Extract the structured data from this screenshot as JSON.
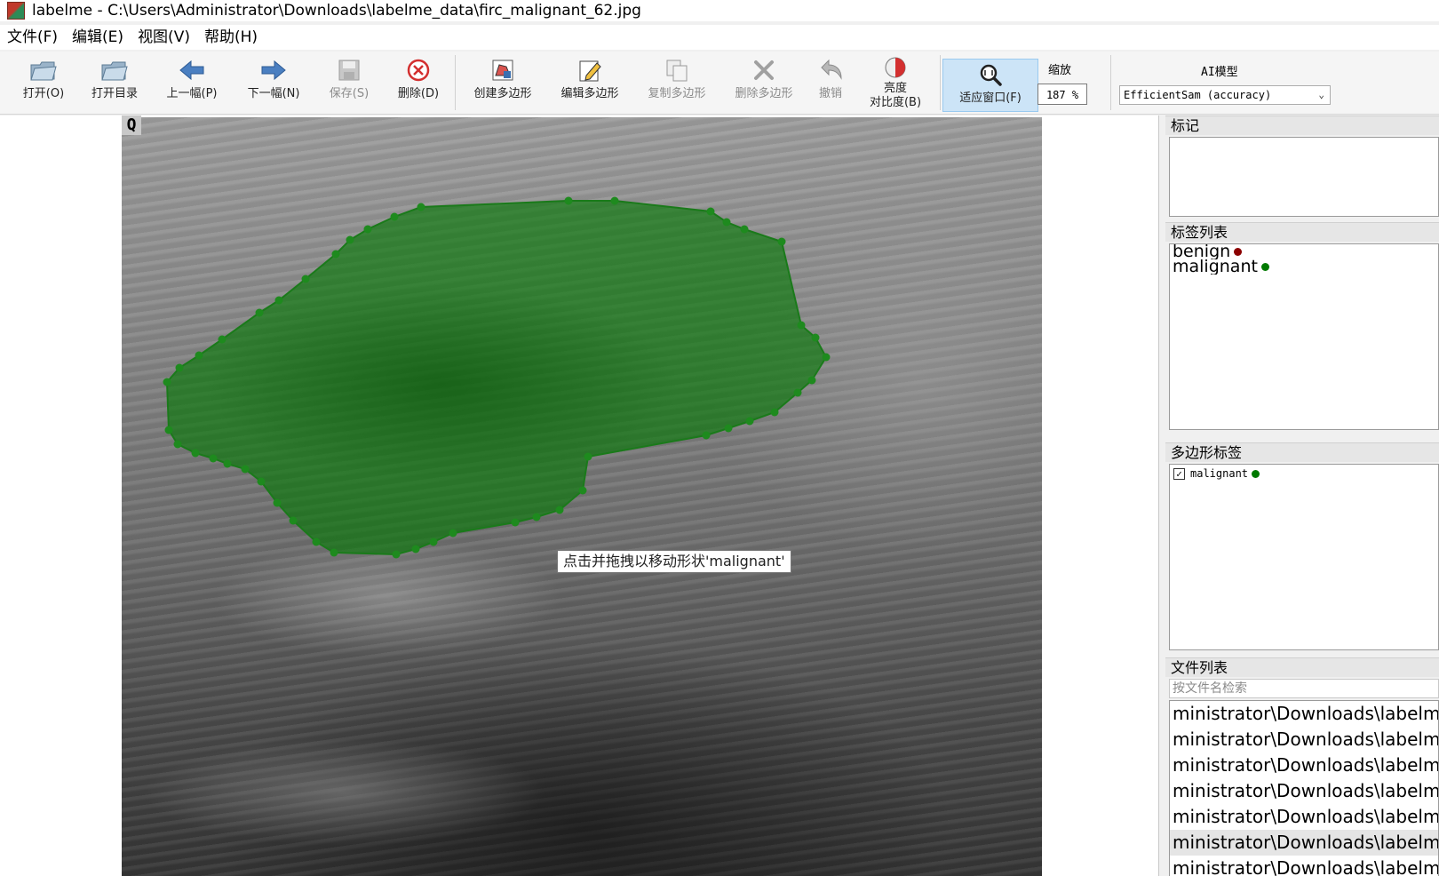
{
  "window": {
    "title": "labelme - C:\\Users\\Administrator\\Downloads\\labelme_data\\firc_malignant_62.jpg"
  },
  "menu": {
    "items": [
      "文件(F)",
      "编辑(E)",
      "视图(V)",
      "帮助(H)"
    ]
  },
  "toolbar": {
    "open": "打开(O)",
    "open_dir": "打开目录",
    "prev": "上一幅(P)",
    "next": "下一幅(N)",
    "save": "保存(S)",
    "delete_file": "删除(D)",
    "create_polygon": "创建多边形",
    "edit_polygon": "编辑多边形",
    "copy_polygon": "复制多边形",
    "delete_polygon": "删除多边形",
    "undo": "撤销",
    "brightness_line1": "亮度",
    "brightness_line2": "对比度(B)",
    "fit_window": "适应窗口(F)",
    "zoom_label": "缩放",
    "zoom_value": "187 %",
    "ai_label": "AI模型",
    "ai_model": "EfficientSam (accuracy)"
  },
  "canvas": {
    "image_marker": "Q",
    "tooltip": "点击并拖拽以移动形状'malignant'",
    "shape_color": "#1e7a1e"
  },
  "panels": {
    "flags_title": "标记",
    "labels_title": "标签列表",
    "label_items": [
      {
        "name": "benign",
        "color": "#8b0000"
      },
      {
        "name": "malignant",
        "color": "#007a00"
      }
    ],
    "polygons_title": "多边形标签",
    "polygon_items": [
      {
        "name": "malignant",
        "checked": true,
        "color": "#007a00"
      }
    ],
    "files_title": "文件列表",
    "file_search_placeholder": "按文件名检索",
    "file_items": [
      "ministrator\\Downloads\\labelme",
      "ministrator\\Downloads\\labelme",
      "ministrator\\Downloads\\labelme",
      "ministrator\\Downloads\\labelme",
      "ministrator\\Downloads\\labelme",
      "ministrator\\Downloads\\labelme",
      "ministrator\\Downloads\\labelme"
    ]
  }
}
